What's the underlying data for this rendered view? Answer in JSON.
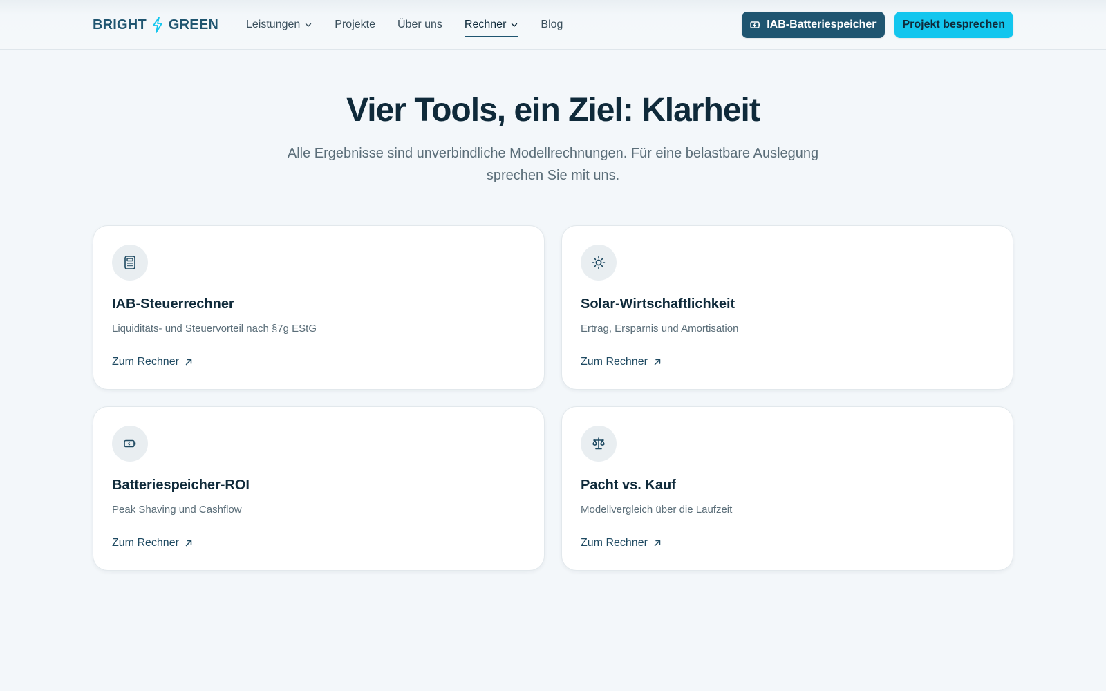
{
  "brand": {
    "left": "BRIGHT",
    "right": "GREEN"
  },
  "nav": {
    "items": [
      {
        "label": "Leistungen",
        "dropdown": true,
        "active": false
      },
      {
        "label": "Projekte",
        "dropdown": false,
        "active": false
      },
      {
        "label": "Über uns",
        "dropdown": false,
        "active": false
      },
      {
        "label": "Rechner",
        "dropdown": true,
        "active": true
      },
      {
        "label": "Blog",
        "dropdown": false,
        "active": false
      }
    ]
  },
  "actions": {
    "battery_label": "IAB-Batteriespeicher",
    "cta_label": "Projekt besprechen"
  },
  "hero": {
    "title": "Vier Tools, ein Ziel: Klarheit",
    "subtitle": "Alle Ergebnisse sind unverbindliche Modellrechnungen. Für eine belastbare Auslegung sprechen Sie mit uns."
  },
  "cards": [
    {
      "icon": "calculator-icon",
      "title": "IAB-Steuerrechner",
      "description": "Liquiditäts- und Steuervorteil nach §7g EStG",
      "link": "Zum Rechner"
    },
    {
      "icon": "sun-icon",
      "title": "Solar-Wirtschaftlichkeit",
      "description": "Ertrag, Ersparnis und Amortisation",
      "link": "Zum Rechner"
    },
    {
      "icon": "battery-icon",
      "title": "Batteriespeicher-ROI",
      "description": "Peak Shaving und Cashflow",
      "link": "Zum Rechner"
    },
    {
      "icon": "scale-icon",
      "title": "Pacht vs. Kauf",
      "description": "Modellvergleich über die Laufzeit",
      "link": "Zum Rechner"
    }
  ],
  "colors": {
    "brand_dark": "#1f5570",
    "accent_cyan": "#13c6ee",
    "background": "#f3f7fa"
  }
}
